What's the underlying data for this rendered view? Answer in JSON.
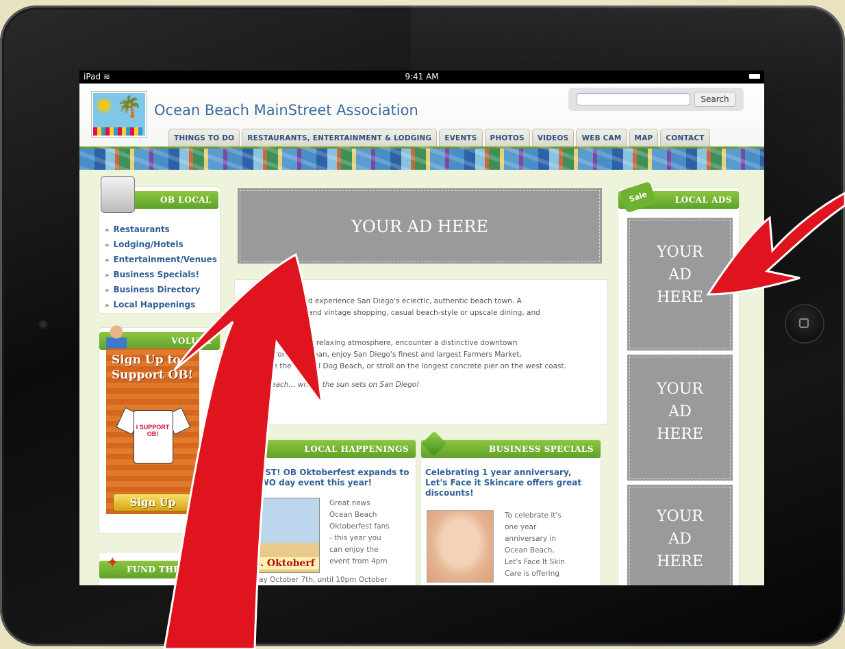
{
  "device": {
    "status_left": "iPad",
    "time": "9:41 AM"
  },
  "site": {
    "title": "Ocean Beach MainStreet Association",
    "search": {
      "placeholder": "",
      "button": "Search"
    },
    "nav": [
      "THINGS TO DO",
      "RESTAURANTS, ENTERTAINMENT & LODGING",
      "EVENTS",
      "PHOTOS",
      "VIDEOS",
      "WEB CAM",
      "MAP",
      "CONTACT"
    ]
  },
  "left": {
    "ob_local": {
      "heading": "OB LOCAL",
      "items": [
        "Restaurants",
        "Lodging/Hotels",
        "Entertainment/Venues",
        "Business Specials!",
        "Business Directory",
        "Local Happenings"
      ]
    },
    "volunteer": {
      "heading": "VOLUNT",
      "promo_line1": "Sign Up to",
      "promo_line2": "Support OB!",
      "shirt_text": "I SUPPORT OB!",
      "button": "Sign Up"
    },
    "fund": {
      "heading": "FUND THE FU"
    }
  },
  "main": {
    "banner_ad": "YOUR AD HERE",
    "intro": {
      "p1_bold": "cean Beach",
      "p1_rest": " and experience San Diego's eclectic, authentic beach town. A",
      "p1_line2": "for fine antique and vintage shopping, casual beach-style or upscale dining, and",
      "p1_line3": "al shops.",
      "p2_line1": "y in our open and relaxing atmosphere, encounter a distinctive downtown",
      "p2_line2": "steps from the ocean, enjoy San Diego's finest and largest Farmers Market,",
      "p2_line3": "erience the original Dog Beach, or stroll on the longest concrete pier on the west coast.",
      "tagline": "ean Beach... where the sun sets on San Diego!"
    },
    "local_happenings": {
      "heading": "LOCAL HAPPENINGS",
      "title": "PROST! OB Oktoberfest expands to a TWO day event this year!",
      "image_label": "B. Oktoberf",
      "body": [
        "Great news",
        "Ocean Beach",
        "Oktoberfest fans",
        "- this year you",
        "can enjoy the",
        "event from 4pm"
      ],
      "body_tail": "Friday October 7th, until 10pm October"
    },
    "business_specials": {
      "heading": "BUSINESS SPECIALS",
      "title": "Celebrating 1 year anniversary, Let's Face it Skincare offers great discounts!",
      "body": [
        "To celebrate it's",
        "one year",
        "anniversary  in",
        "Ocean Beach,",
        "Let's Face It Skin",
        "Care is offering"
      ]
    }
  },
  "right": {
    "heading": "LOCAL ADS",
    "badge": "Sale",
    "ads": [
      [
        "YOUR",
        "AD",
        "HERE"
      ],
      [
        "YOUR",
        "AD",
        "HERE"
      ],
      [
        "YOUR",
        "AD",
        "HERE"
      ]
    ]
  },
  "colors": {
    "accent_green": "#6fb232",
    "link_blue": "#2f5f97",
    "arrow_red": "#e0141e",
    "ad_gray": "#9a9a9a"
  }
}
